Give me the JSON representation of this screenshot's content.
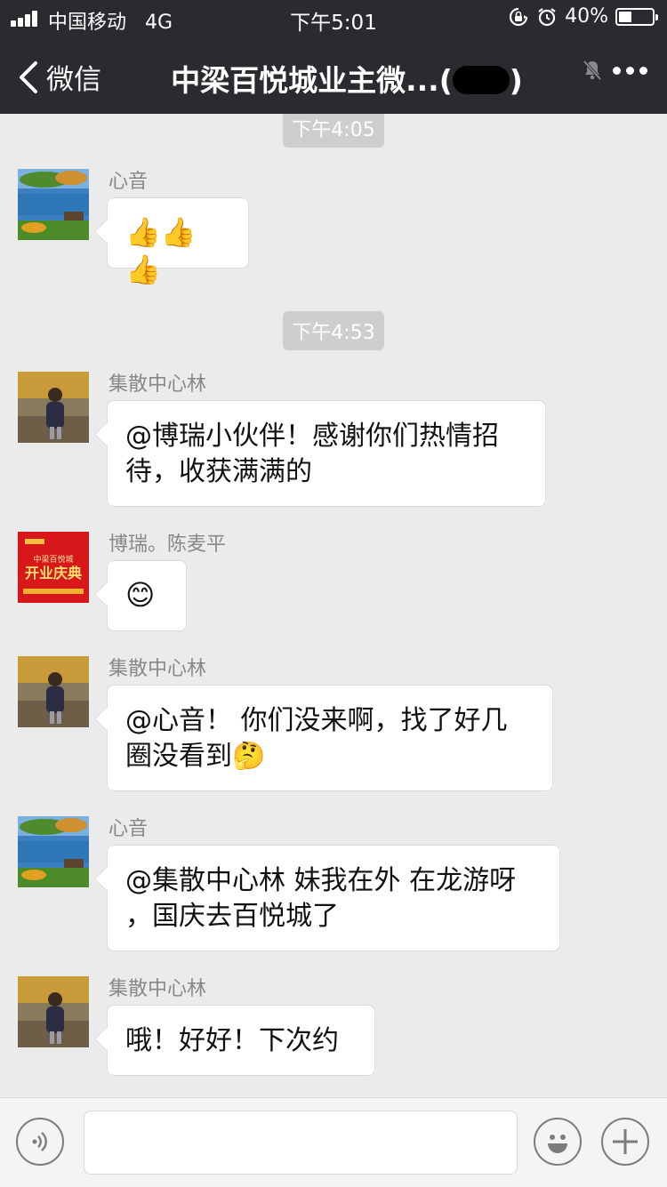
{
  "status_bar": {
    "carrier": "中国移动",
    "network": "4G",
    "time": "下午5:01",
    "battery": "40%",
    "battery_level": 0.4
  },
  "nav": {
    "back_label": "微信",
    "title": "中梁百悦城业主微...(",
    "title_suffix": ")"
  },
  "timestamps": [
    "下午4:05",
    "下午4:53"
  ],
  "messages": [
    {
      "sender": "心音",
      "text": "👍👍👍"
    },
    {
      "sender": "集散中心林",
      "line1": "@博瑞小伙伴！感谢你们热情招",
      "line2": "待，收获满满的"
    },
    {
      "sender": "博瑞。陈麦平",
      "text": "😊"
    },
    {
      "sender": "集散中心林",
      "line1": "@心音！ 你们没来啊，找了好几",
      "line2": "圈没看到🤔"
    },
    {
      "sender": "心音",
      "line1": "@集散中心林 妹我在外 在龙游呀",
      "line2": "，国庆去百悦城了"
    },
    {
      "sender": "集散中心林",
      "text": "哦！好好！下次约"
    }
  ],
  "avatar_poster": {
    "line1": "中梁百悦城",
    "line2": "开业庆典"
  },
  "colors": {
    "topbar": "#2b2b2f",
    "background": "#ebebeb",
    "bubble": "#ffffff",
    "timechip": "#cecece"
  },
  "icons": [
    "signal-icon",
    "orientation-lock-icon",
    "alarm-icon",
    "battery-icon",
    "back-chevron-icon",
    "mute-bell-icon",
    "more-icon",
    "voice-icon",
    "smiley-icon",
    "plus-icon"
  ]
}
